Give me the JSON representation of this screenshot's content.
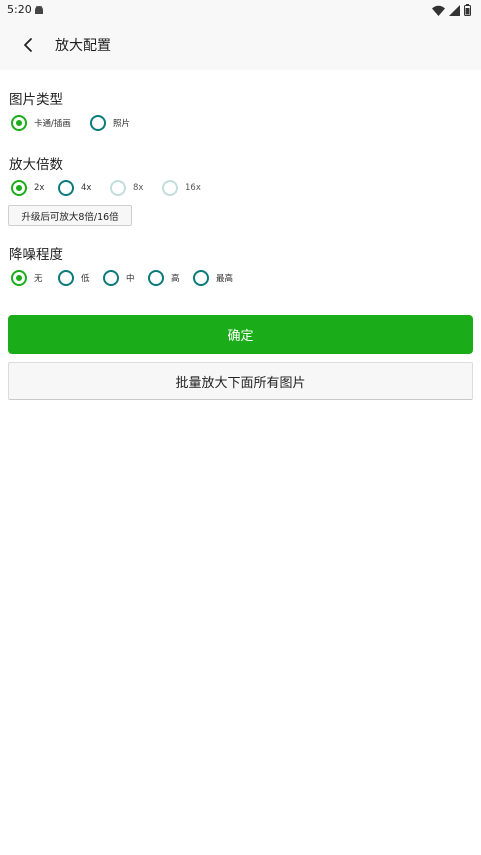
{
  "status_bar": {
    "time": "5:20"
  },
  "app_bar": {
    "title": "放大配置"
  },
  "image_type": {
    "title": "图片类型",
    "options": [
      {
        "label": "卡通/插画",
        "checked": true
      },
      {
        "label": "照片",
        "checked": false
      }
    ]
  },
  "scale": {
    "title": "放大倍数",
    "options": [
      {
        "label": "2x",
        "checked": true,
        "disabled": false
      },
      {
        "label": "4x",
        "checked": false,
        "disabled": false
      },
      {
        "label": "8x",
        "checked": false,
        "disabled": true
      },
      {
        "label": "16x",
        "checked": false,
        "disabled": true
      }
    ],
    "upgrade_label": "升级后可放大8倍/16倍"
  },
  "denoise": {
    "title": "降噪程度",
    "options": [
      {
        "label": "无",
        "checked": true
      },
      {
        "label": "低",
        "checked": false
      },
      {
        "label": "中",
        "checked": false
      },
      {
        "label": "高",
        "checked": false
      },
      {
        "label": "最高",
        "checked": false
      }
    ]
  },
  "actions": {
    "confirm_label": "确定",
    "batch_label": "批量放大下面所有图片"
  },
  "colors": {
    "accent": "#1aad19",
    "radio_border": "#0a7b7a",
    "radio_disabled": "#c3dcdc",
    "bar_background": "#f8f8f8"
  },
  "icons": {
    "status_app": "android-icon",
    "wifi": "wifi-icon",
    "signal": "cell-signal-icon",
    "battery": "battery-icon",
    "back": "back-arrow-icon"
  }
}
